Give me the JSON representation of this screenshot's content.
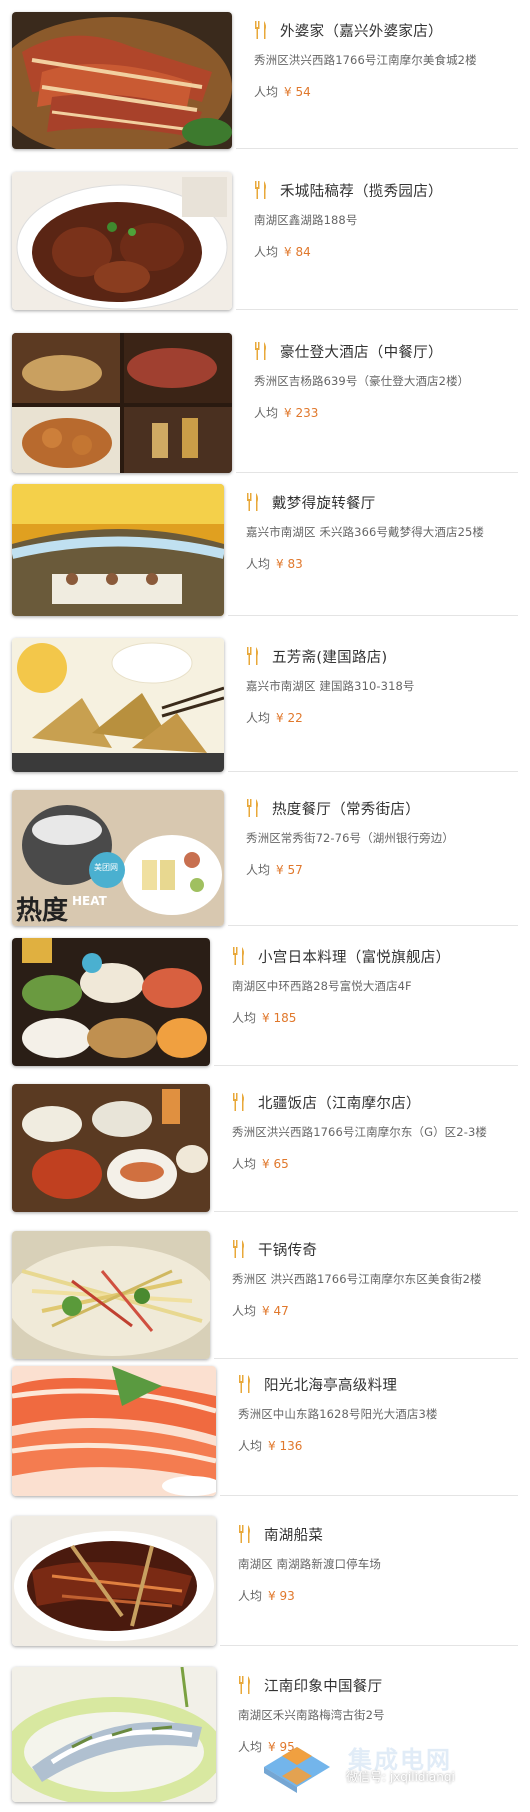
{
  "price_prefix": "人均",
  "restaurants": [
    {
      "name": "外婆家（嘉兴外婆家店）",
      "address": "秀洲区洪兴西路1766号江南摩尔美食城2楼",
      "price": "¥ 54"
    },
    {
      "name": "禾城陆稿荐（揽秀园店）",
      "address": "南湖区鑫湖路188号",
      "price": "¥ 84"
    },
    {
      "name": "豪仕登大酒店（中餐厅）",
      "address": "秀洲区吉杨路639号（豪仕登大酒店2楼）",
      "price": "¥ 233"
    },
    {
      "name": "戴梦得旋转餐厅",
      "address": "嘉兴市南湖区 禾兴路366号戴梦得大酒店25楼",
      "price": "¥ 83"
    },
    {
      "name": "五芳斋(建国路店)",
      "address": "嘉兴市南湖区 建国路310-318号",
      "price": "¥ 22"
    },
    {
      "name": "热度餐厅（常秀街店）",
      "address": "秀洲区常秀街72-76号（湖州银行旁边）",
      "price": "¥ 57"
    },
    {
      "name": "小宫日本料理（富悦旗舰店）",
      "address": "南湖区中环西路28号富悦大酒店4F",
      "price": "¥ 185"
    },
    {
      "name": "北疆饭店（江南摩尔店）",
      "address": "秀洲区洪兴西路1766号江南摩尔东（G）区2-3楼",
      "price": "¥ 65"
    },
    {
      "name": "干锅传奇",
      "address": "秀洲区 洪兴西路1766号江南摩尔东区美食街2楼",
      "price": "¥ 47"
    },
    {
      "name": "阳光北海亭高级料理",
      "address": "秀洲区中山东路1628号阳光大酒店3楼",
      "price": "¥ 136"
    },
    {
      "name": "南湖船菜",
      "address": "南湖区 南湖路新渡口停车场",
      "price": "¥ 93"
    },
    {
      "name": "江南印象中国餐厅",
      "address": "南湖区禾兴南路梅湾古街2号",
      "price": "¥ 95"
    }
  ],
  "thumb_labels": {
    "heat_brand": "热度",
    "heat_en": "HEAT",
    "meituan": "美团网"
  },
  "watermark": {
    "wechat_label": "微信号: jxqilidianqi",
    "big_text": "集成电网"
  },
  "colors": {
    "price": "#e0782c",
    "fork_icon": "#e8a83a",
    "text": "#333333",
    "muted": "#666666",
    "divider": "#e4e4e4"
  }
}
